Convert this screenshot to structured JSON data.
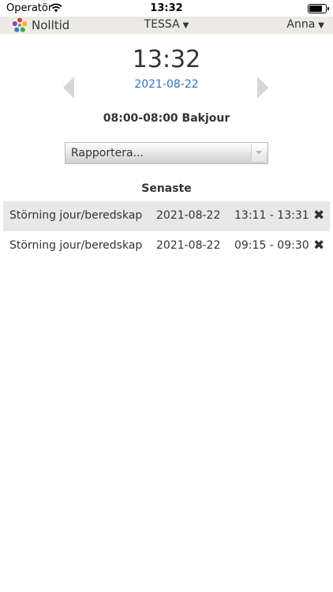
{
  "status_bar": {
    "carrier": "Operatör",
    "time": "13:32",
    "battery_level": 0.9
  },
  "header": {
    "brand": "Nolltid",
    "selector": "TESSA",
    "user": "Anna",
    "caret": "▼"
  },
  "main": {
    "time": "13:32",
    "date": "2021-08-22",
    "shift": "08:00-08:00 Bakjour",
    "report_placeholder": "Rapportera...",
    "section_title": "Senaste"
  },
  "recent": [
    {
      "type": "Störning jour/beredskap",
      "date": "2021-08-22",
      "time": "13:11 - 13:31",
      "delete": "✖"
    },
    {
      "type": "Störning jour/beredskap",
      "date": "2021-08-22",
      "time": "09:15 - 09:30",
      "delete": "✖"
    }
  ],
  "colors": {
    "header_bg": "#ecebe3",
    "link": "#2f74c0",
    "row_highlight": "#e8e8e8"
  }
}
